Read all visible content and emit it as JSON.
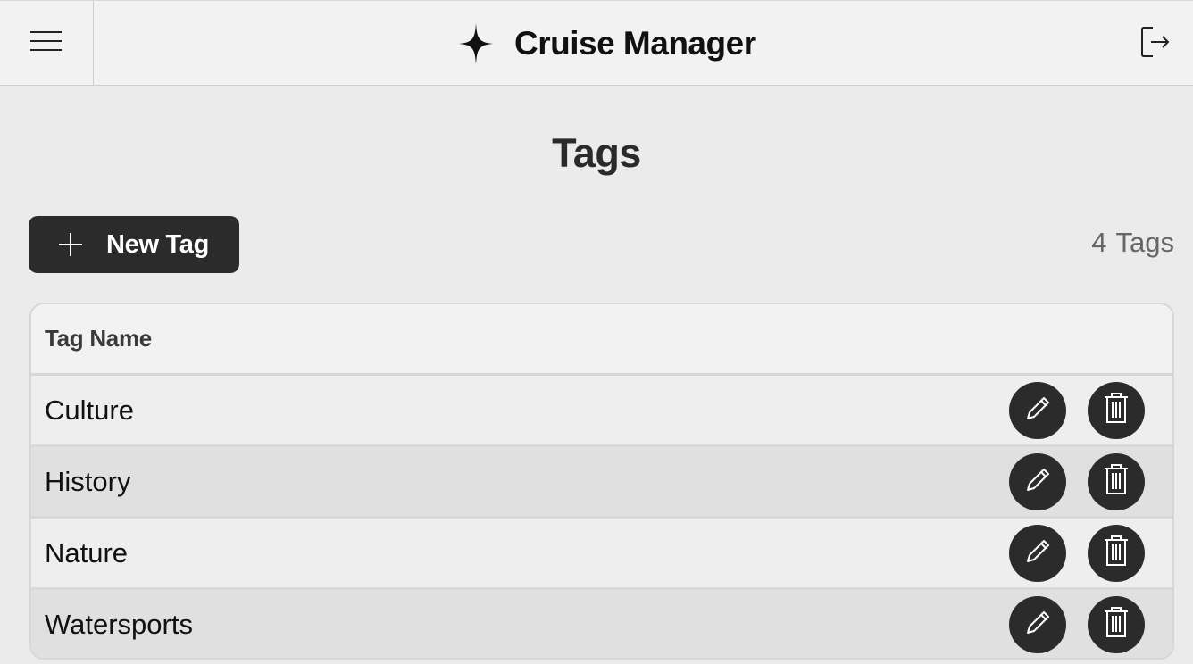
{
  "header": {
    "app_title": "Cruise Manager",
    "menu_icon": "hamburger-menu-icon",
    "brand_icon": "sparkle-star-icon",
    "logout_icon": "logout-icon"
  },
  "page": {
    "title": "Tags"
  },
  "toolbar": {
    "new_tag_label": "New Tag",
    "new_tag_icon": "plus-icon",
    "count_number": "4",
    "count_label": "Tags"
  },
  "table": {
    "columns": [
      "Tag Name"
    ],
    "rows": [
      {
        "name": "Culture"
      },
      {
        "name": "History"
      },
      {
        "name": "Nature"
      },
      {
        "name": "Watersports"
      }
    ],
    "row_actions": {
      "edit_icon": "pencil-icon",
      "delete_icon": "trash-icon"
    }
  },
  "colors": {
    "background": "#ebebeb",
    "header_background": "#f2f2f2",
    "primary_button": "#2b2b2b",
    "row_alt": "#e0e0e0",
    "muted_text": "#666666"
  }
}
